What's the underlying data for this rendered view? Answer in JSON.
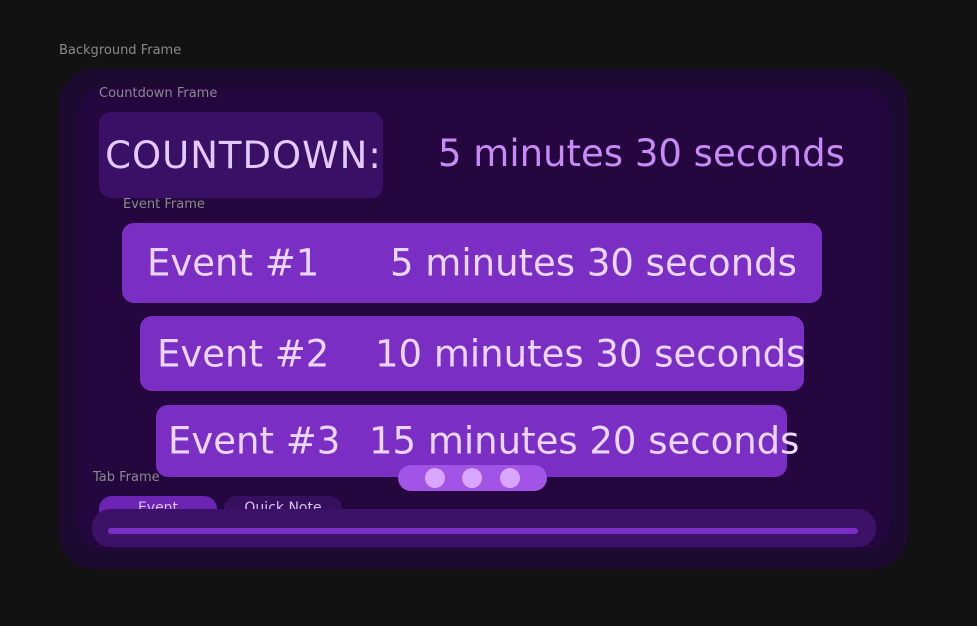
{
  "captions": {
    "background_frame": "Background Frame",
    "countdown_frame": "Countdown Frame",
    "event_frame": "Event Frame",
    "tab_frame": "Tab Frame"
  },
  "countdown": {
    "label": "COUNTDOWN:",
    "value": "5 minutes 30 seconds"
  },
  "events": [
    {
      "name": "Event #1",
      "time": "5 minutes 30 seconds"
    },
    {
      "name": "Event #2",
      "time": "10 minutes 30 seconds"
    },
    {
      "name": "Event #3",
      "time": "15 minutes 20 seconds"
    }
  ],
  "tabs": [
    {
      "label": "Event",
      "active": true
    },
    {
      "label": "Quick Note",
      "active": false
    }
  ],
  "pager": {
    "pages": 3
  },
  "colors": {
    "page_background": "#121212",
    "background_frame": "#1d0a31",
    "countdown_frame": "#24073f",
    "event_row": "#7a2ec4",
    "accent_text": "#c98af7",
    "light_text": "#ead6ff"
  }
}
